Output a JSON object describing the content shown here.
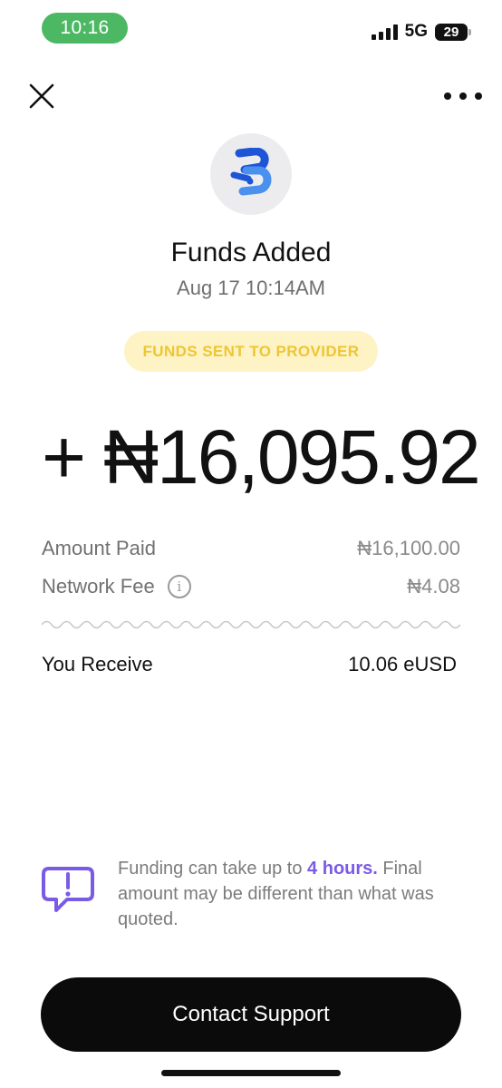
{
  "status_bar": {
    "time": "10:16",
    "network": "5G",
    "battery": "29",
    "time_pill_color": "#4cb864"
  },
  "header": {
    "close_icon": "close-icon",
    "more_icon": "more-horizontal-icon"
  },
  "transaction": {
    "logo_icon": "provider-logo-icon",
    "title": "Funds Added",
    "date": "Aug 17 10:14AM",
    "status": "FUNDS SENT TO PROVIDER",
    "amount": "+ ₦16,095.92"
  },
  "details": {
    "amount_paid_label": "Amount Paid",
    "amount_paid_value": "₦16,100.00",
    "network_fee_label": "Network Fee",
    "network_fee_value": "₦4.08",
    "info_icon": "info-icon",
    "receive_label": "You Receive",
    "receive_value": "10.06 eUSD"
  },
  "notice": {
    "icon": "alert-chat-icon",
    "text_before": "Funding can take up to ",
    "highlight": "4 hours.",
    "text_after": " Final amount may be different than what was quoted.",
    "highlight_color": "#7b5be6"
  },
  "actions": {
    "contact_support_label": "Contact Support"
  },
  "colors": {
    "badge_bg": "#fdf3c4",
    "badge_text": "#efc532",
    "button_bg": "#0b0b0b"
  }
}
